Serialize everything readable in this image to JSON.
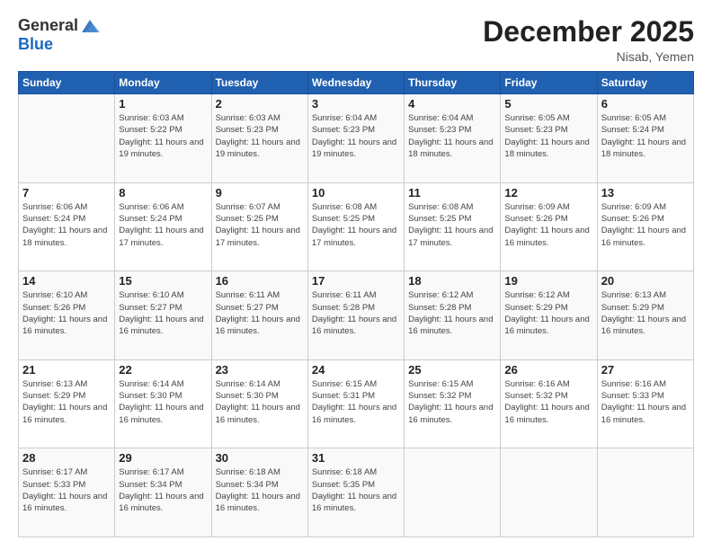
{
  "header": {
    "logo": {
      "general": "General",
      "blue": "Blue"
    },
    "title": "December 2025",
    "location": "Nisab, Yemen"
  },
  "calendar": {
    "weekdays": [
      "Sunday",
      "Monday",
      "Tuesday",
      "Wednesday",
      "Thursday",
      "Friday",
      "Saturday"
    ],
    "weeks": [
      [
        {
          "day": "",
          "sunrise": "",
          "sunset": "",
          "daylight": ""
        },
        {
          "day": "1",
          "sunrise": "Sunrise: 6:03 AM",
          "sunset": "Sunset: 5:22 PM",
          "daylight": "Daylight: 11 hours and 19 minutes."
        },
        {
          "day": "2",
          "sunrise": "Sunrise: 6:03 AM",
          "sunset": "Sunset: 5:23 PM",
          "daylight": "Daylight: 11 hours and 19 minutes."
        },
        {
          "day": "3",
          "sunrise": "Sunrise: 6:04 AM",
          "sunset": "Sunset: 5:23 PM",
          "daylight": "Daylight: 11 hours and 19 minutes."
        },
        {
          "day": "4",
          "sunrise": "Sunrise: 6:04 AM",
          "sunset": "Sunset: 5:23 PM",
          "daylight": "Daylight: 11 hours and 18 minutes."
        },
        {
          "day": "5",
          "sunrise": "Sunrise: 6:05 AM",
          "sunset": "Sunset: 5:23 PM",
          "daylight": "Daylight: 11 hours and 18 minutes."
        },
        {
          "day": "6",
          "sunrise": "Sunrise: 6:05 AM",
          "sunset": "Sunset: 5:24 PM",
          "daylight": "Daylight: 11 hours and 18 minutes."
        }
      ],
      [
        {
          "day": "7",
          "sunrise": "Sunrise: 6:06 AM",
          "sunset": "Sunset: 5:24 PM",
          "daylight": "Daylight: 11 hours and 18 minutes."
        },
        {
          "day": "8",
          "sunrise": "Sunrise: 6:06 AM",
          "sunset": "Sunset: 5:24 PM",
          "daylight": "Daylight: 11 hours and 17 minutes."
        },
        {
          "day": "9",
          "sunrise": "Sunrise: 6:07 AM",
          "sunset": "Sunset: 5:25 PM",
          "daylight": "Daylight: 11 hours and 17 minutes."
        },
        {
          "day": "10",
          "sunrise": "Sunrise: 6:08 AM",
          "sunset": "Sunset: 5:25 PM",
          "daylight": "Daylight: 11 hours and 17 minutes."
        },
        {
          "day": "11",
          "sunrise": "Sunrise: 6:08 AM",
          "sunset": "Sunset: 5:25 PM",
          "daylight": "Daylight: 11 hours and 17 minutes."
        },
        {
          "day": "12",
          "sunrise": "Sunrise: 6:09 AM",
          "sunset": "Sunset: 5:26 PM",
          "daylight": "Daylight: 11 hours and 16 minutes."
        },
        {
          "day": "13",
          "sunrise": "Sunrise: 6:09 AM",
          "sunset": "Sunset: 5:26 PM",
          "daylight": "Daylight: 11 hours and 16 minutes."
        }
      ],
      [
        {
          "day": "14",
          "sunrise": "Sunrise: 6:10 AM",
          "sunset": "Sunset: 5:26 PM",
          "daylight": "Daylight: 11 hours and 16 minutes."
        },
        {
          "day": "15",
          "sunrise": "Sunrise: 6:10 AM",
          "sunset": "Sunset: 5:27 PM",
          "daylight": "Daylight: 11 hours and 16 minutes."
        },
        {
          "day": "16",
          "sunrise": "Sunrise: 6:11 AM",
          "sunset": "Sunset: 5:27 PM",
          "daylight": "Daylight: 11 hours and 16 minutes."
        },
        {
          "day": "17",
          "sunrise": "Sunrise: 6:11 AM",
          "sunset": "Sunset: 5:28 PM",
          "daylight": "Daylight: 11 hours and 16 minutes."
        },
        {
          "day": "18",
          "sunrise": "Sunrise: 6:12 AM",
          "sunset": "Sunset: 5:28 PM",
          "daylight": "Daylight: 11 hours and 16 minutes."
        },
        {
          "day": "19",
          "sunrise": "Sunrise: 6:12 AM",
          "sunset": "Sunset: 5:29 PM",
          "daylight": "Daylight: 11 hours and 16 minutes."
        },
        {
          "day": "20",
          "sunrise": "Sunrise: 6:13 AM",
          "sunset": "Sunset: 5:29 PM",
          "daylight": "Daylight: 11 hours and 16 minutes."
        }
      ],
      [
        {
          "day": "21",
          "sunrise": "Sunrise: 6:13 AM",
          "sunset": "Sunset: 5:29 PM",
          "daylight": "Daylight: 11 hours and 16 minutes."
        },
        {
          "day": "22",
          "sunrise": "Sunrise: 6:14 AM",
          "sunset": "Sunset: 5:30 PM",
          "daylight": "Daylight: 11 hours and 16 minutes."
        },
        {
          "day": "23",
          "sunrise": "Sunrise: 6:14 AM",
          "sunset": "Sunset: 5:30 PM",
          "daylight": "Daylight: 11 hours and 16 minutes."
        },
        {
          "day": "24",
          "sunrise": "Sunrise: 6:15 AM",
          "sunset": "Sunset: 5:31 PM",
          "daylight": "Daylight: 11 hours and 16 minutes."
        },
        {
          "day": "25",
          "sunrise": "Sunrise: 6:15 AM",
          "sunset": "Sunset: 5:32 PM",
          "daylight": "Daylight: 11 hours and 16 minutes."
        },
        {
          "day": "26",
          "sunrise": "Sunrise: 6:16 AM",
          "sunset": "Sunset: 5:32 PM",
          "daylight": "Daylight: 11 hours and 16 minutes."
        },
        {
          "day": "27",
          "sunrise": "Sunrise: 6:16 AM",
          "sunset": "Sunset: 5:33 PM",
          "daylight": "Daylight: 11 hours and 16 minutes."
        }
      ],
      [
        {
          "day": "28",
          "sunrise": "Sunrise: 6:17 AM",
          "sunset": "Sunset: 5:33 PM",
          "daylight": "Daylight: 11 hours and 16 minutes."
        },
        {
          "day": "29",
          "sunrise": "Sunrise: 6:17 AM",
          "sunset": "Sunset: 5:34 PM",
          "daylight": "Daylight: 11 hours and 16 minutes."
        },
        {
          "day": "30",
          "sunrise": "Sunrise: 6:18 AM",
          "sunset": "Sunset: 5:34 PM",
          "daylight": "Daylight: 11 hours and 16 minutes."
        },
        {
          "day": "31",
          "sunrise": "Sunrise: 6:18 AM",
          "sunset": "Sunset: 5:35 PM",
          "daylight": "Daylight: 11 hours and 16 minutes."
        },
        {
          "day": "",
          "sunrise": "",
          "sunset": "",
          "daylight": ""
        },
        {
          "day": "",
          "sunrise": "",
          "sunset": "",
          "daylight": ""
        },
        {
          "day": "",
          "sunrise": "",
          "sunset": "",
          "daylight": ""
        }
      ]
    ]
  }
}
